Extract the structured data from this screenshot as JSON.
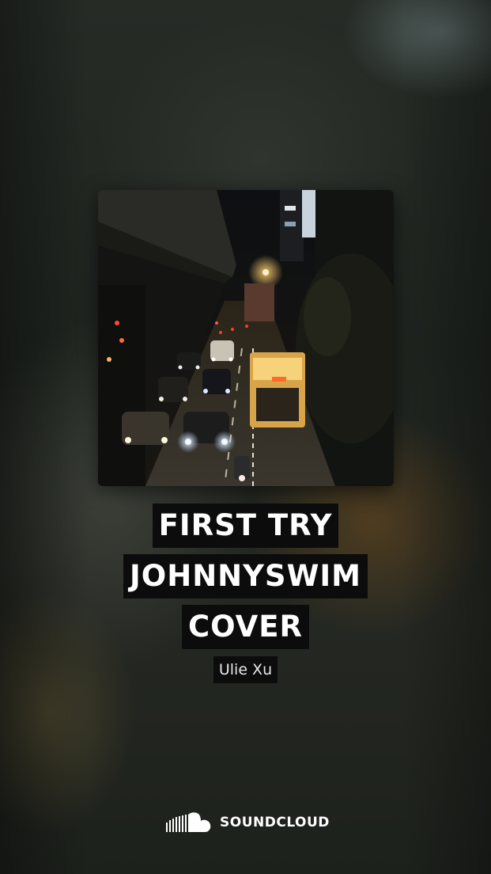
{
  "track": {
    "title_lines": [
      "FIRST TRY",
      "JOHNNYSWIM",
      "COVER"
    ],
    "artist": "Ulie Xu"
  },
  "brand": {
    "name": "SOUNDCLOUD",
    "icon": "soundcloud-logo-icon"
  },
  "artwork": {
    "description_icon": "night-traffic-photo"
  },
  "colors": {
    "title_bg": "#0c0c0c",
    "title_text": "#ffffff",
    "background": "#1f241f"
  }
}
